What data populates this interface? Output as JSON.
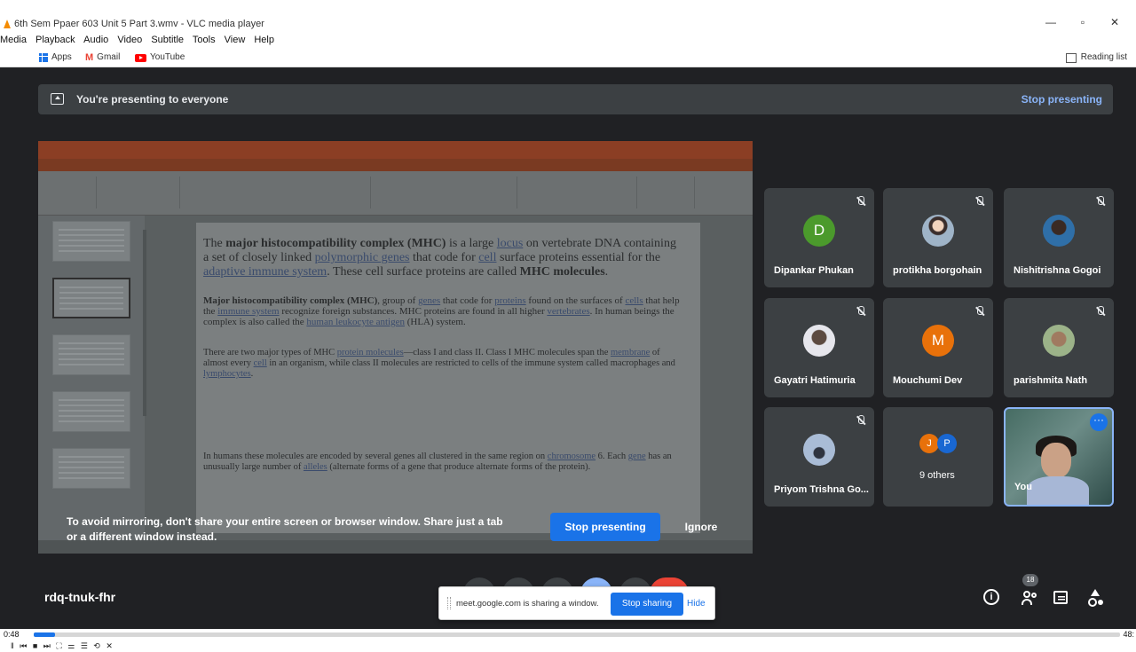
{
  "vlc": {
    "title": "6th Sem Ppaer 603 Unit 5 Part 3.wmv - VLC media player",
    "menu": [
      "Media",
      "Playback",
      "Audio",
      "Video",
      "Subtitle",
      "Tools",
      "View",
      "Help"
    ],
    "time_elapsed": "0:48",
    "time_total": "48:",
    "progress_fraction": 0.02,
    "controls_text": "‖  ⏮ ■ ⏭  ⛶ ⚌  ☰ ⟲ ✕"
  },
  "bookmarks": {
    "apps": "Apps",
    "gmail": "Gmail",
    "youtube": "YouTube",
    "reading_list": "Reading list"
  },
  "presenting_bar": {
    "text": "You're presenting to everyone",
    "stop": "Stop presenting"
  },
  "slide": {
    "p1": {
      "a": "The ",
      "b": "major histocompatibility complex (MHC)",
      "c": " is a large ",
      "d": "locus",
      "e": " on vertebrate DNA containing a set of closely linked ",
      "f": "polymorphic genes",
      "g": " that code for ",
      "h": "cell",
      "i": " surface proteins essential for the ",
      "j": "adaptive immune system",
      "k": ". These cell surface proteins are called ",
      "l": "MHC molecules",
      "m": "."
    },
    "p2": {
      "a": "Major histocompatibility complex (MHC)",
      "b": ", group of ",
      "c": "genes",
      "d": " that code for ",
      "e": "proteins",
      "f": " found on the surfaces of ",
      "g": "cells",
      "h": " that help the ",
      "i": "immune system",
      "j": " recognize foreign substances. MHC proteins are found in all higher ",
      "k": "vertebrates",
      "l": ". In human beings the complex is also called the ",
      "m": "human leukocyte antigen",
      "n": " (HLA) system."
    },
    "p3": {
      "a": "There are two major types of MHC ",
      "b": "protein molecules",
      "c": "—class I and class II. Class I MHC molecules span the ",
      "d": "membrane",
      "e": " of almost every ",
      "f": "cell",
      "g": " in an organism, while class II molecules are restricted to cells of the immune system called macrophages and ",
      "h": "lymphocytes",
      "i": "."
    },
    "p4": {
      "a": "In humans these molecules are encoded by several genes all clustered in the same region on ",
      "b": "chromosome",
      "c": " 6. Each ",
      "d": "gene",
      "e": " has an unusually large number of ",
      "f": "alleles",
      "g": " (alternate forms of a gene that produce alternate forms of the protein)."
    }
  },
  "warning": {
    "line1": "To avoid mirroring, don't share your entire screen or browser window. Share just a tab",
    "line2": "or a different window instead.",
    "stop": "Stop presenting",
    "ignore": "Ignore"
  },
  "participants": [
    {
      "name": "Dipankar Phukan",
      "initial": "D",
      "color": "#4b9a2c"
    },
    {
      "name": "protikha borgohain",
      "initial": "",
      "color": ""
    },
    {
      "name": "Nishitrishna Gogoi",
      "initial": "",
      "color": ""
    },
    {
      "name": "Gayatri Hatimuria",
      "initial": "",
      "color": ""
    },
    {
      "name": "Mouchumi Dev",
      "initial": "M",
      "color": "#e8710a"
    },
    {
      "name": "parishmita Nath",
      "initial": "",
      "color": ""
    },
    {
      "name": "Priyom Trishna Go...",
      "initial": "",
      "color": ""
    }
  ],
  "others": {
    "label": "9 others",
    "a": "J",
    "a_color": "#e8710a",
    "b": "P",
    "b_color": "#1967d2"
  },
  "self_label": "You",
  "meeting_code": "rdq-tnuk-fhr",
  "people_count": "18",
  "sharing_bar": {
    "message": "meet.google.com is sharing a window.",
    "stop": "Stop sharing",
    "hide": "Hide"
  }
}
